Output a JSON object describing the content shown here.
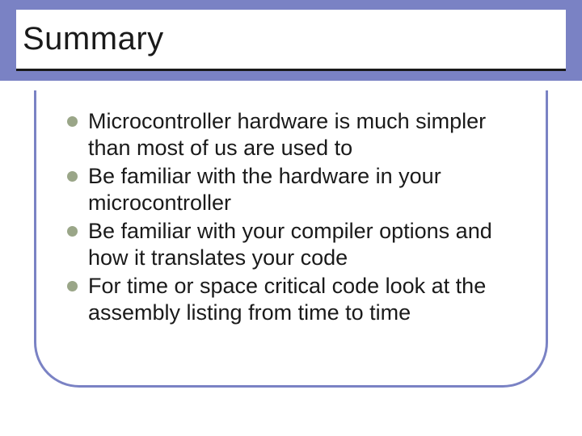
{
  "slide": {
    "title": "Summary",
    "bullets": [
      "Microcontroller hardware is much simpler than most of us are used to",
      "Be familiar with the hardware in your microcontroller",
      "Be familiar with your compiler options and how it translates your code",
      "For time or space critical code look at the assembly listing from time to time"
    ]
  }
}
